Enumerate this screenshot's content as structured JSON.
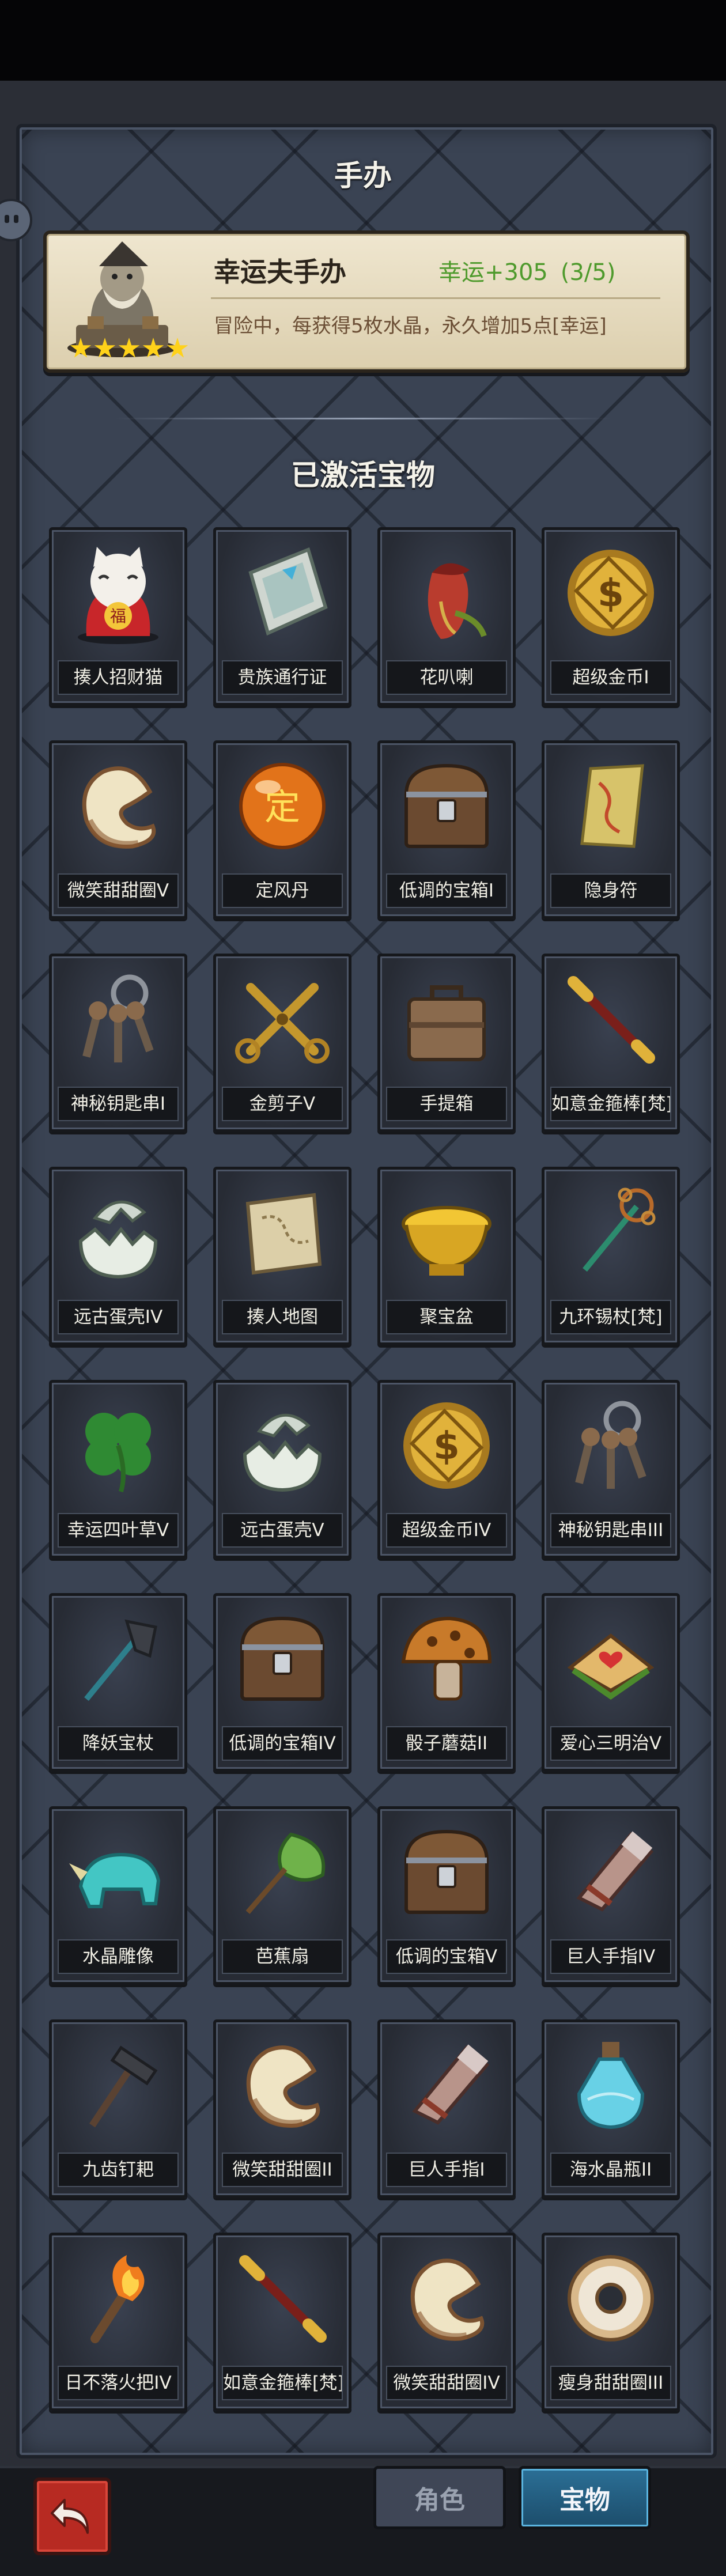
{
  "header": {
    "figurine_title": "手办",
    "treasure_title": "已激活宝物"
  },
  "figurine": {
    "name": "幸运夫手办",
    "bonus": "幸运+305",
    "progress": "(3/5)",
    "description": "冒险中，每获得5枚水晶，永久增加5点[幸运]",
    "stars": 5
  },
  "treasures": [
    {
      "label": "揍人招财猫",
      "icon": "lucky-cat-icon"
    },
    {
      "label": "贵族通行证",
      "icon": "noble-pass-icon"
    },
    {
      "label": "花叭喇",
      "icon": "pitcher-plant-icon"
    },
    {
      "label": "超级金币I",
      "icon": "gold-coin-icon"
    },
    {
      "label": "微笑甜甜圈V",
      "icon": "smile-donut-icon"
    },
    {
      "label": "定风丹",
      "icon": "wind-pill-icon"
    },
    {
      "label": "低调的宝箱I",
      "icon": "treasure-chest-icon"
    },
    {
      "label": "隐身符",
      "icon": "invisibility-charm-icon"
    },
    {
      "label": "神秘钥匙串I",
      "icon": "key-ring-icon"
    },
    {
      "label": "金剪子V",
      "icon": "golden-scissors-icon"
    },
    {
      "label": "手提箱",
      "icon": "suitcase-icon"
    },
    {
      "label": "如意金箍棒[梵]",
      "icon": "golden-staff-icon"
    },
    {
      "label": "远古蛋壳IV",
      "icon": "eggshell-icon"
    },
    {
      "label": "揍人地图",
      "icon": "map-scroll-icon"
    },
    {
      "label": "聚宝盆",
      "icon": "treasure-bowl-icon"
    },
    {
      "label": "九环锡杖[梵]",
      "icon": "monk-staff-icon"
    },
    {
      "label": "幸运四叶草V",
      "icon": "four-leaf-clover-icon"
    },
    {
      "label": "远古蛋壳V",
      "icon": "eggshell-icon"
    },
    {
      "label": "超级金币IV",
      "icon": "gold-coin-icon"
    },
    {
      "label": "神秘钥匙串III",
      "icon": "key-ring-icon"
    },
    {
      "label": "降妖宝杖",
      "icon": "demon-staff-icon"
    },
    {
      "label": "低调的宝箱IV",
      "icon": "treasure-chest-icon"
    },
    {
      "label": "骰子蘑菇II",
      "icon": "dice-mushroom-icon"
    },
    {
      "label": "爱心三明治V",
      "icon": "heart-sandwich-icon"
    },
    {
      "label": "水晶雕像",
      "icon": "crystal-rhino-icon"
    },
    {
      "label": "芭蕉扇",
      "icon": "banana-fan-icon"
    },
    {
      "label": "低调的宝箱V",
      "icon": "treasure-chest-icon"
    },
    {
      "label": "巨人手指IV",
      "icon": "giant-finger-icon"
    },
    {
      "label": "九齿钉耙",
      "icon": "nine-tooth-rake-icon"
    },
    {
      "label": "微笑甜甜圈II",
      "icon": "smile-donut-icon"
    },
    {
      "label": "巨人手指I",
      "icon": "giant-finger-icon"
    },
    {
      "label": "海水晶瓶II",
      "icon": "sea-crystal-bottle-icon"
    },
    {
      "label": "日不落火把IV",
      "icon": "torch-icon"
    },
    {
      "label": "如意金箍棒[梵]",
      "icon": "golden-staff-icon"
    },
    {
      "label": "微笑甜甜圈IV",
      "icon": "smile-donut-icon"
    },
    {
      "label": "瘦身甜甜圈III",
      "icon": "slim-donut-icon"
    }
  ],
  "bottom_nav": {
    "back_icon": "back-arrow-icon",
    "tab_role": "角色",
    "tab_treasure": "宝物",
    "active_tab": "宝物"
  }
}
